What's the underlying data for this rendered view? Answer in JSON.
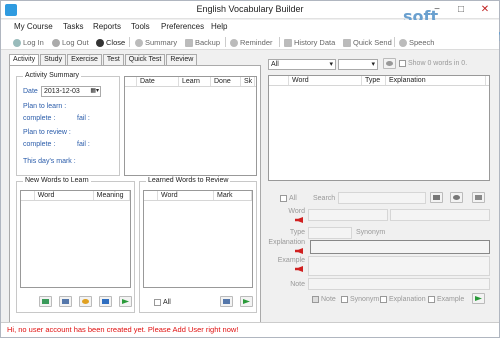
{
  "window": {
    "title": "English Vocabulary Builder",
    "min": "−",
    "max": "□",
    "close": "✕"
  },
  "menu": [
    "My Course",
    "Tasks",
    "Reports",
    "Tools",
    "Preferences",
    "Help"
  ],
  "toolbar": {
    "login": "Log In",
    "logout": "Log Out",
    "close": "Close",
    "summary": "Summary",
    "backup": "Backup",
    "reminder": "Reminder",
    "history": "History Data",
    "quicksend": "Quick Send",
    "speech": "Speech"
  },
  "tabs": [
    "Activity",
    "Study",
    "Exercise",
    "Test",
    "Quick Test",
    "Review"
  ],
  "activity": {
    "group_title": "Activity Summary",
    "date_label": "Date",
    "date_value": "2013-12-03",
    "plan_learn": "Plan to learn :",
    "complete1": "complete :",
    "fail1": "fail :",
    "plan_review": "Plan to review :",
    "complete2": "complete :",
    "fail2": "fail :",
    "days_mark": "This day's mark :"
  },
  "activity_list": {
    "columns": [
      "Date",
      "Learn",
      "Done",
      "Sk"
    ]
  },
  "new_words": {
    "title": "New Words to Learn",
    "columns": [
      "Word",
      "Meaning"
    ]
  },
  "learned_words": {
    "title": "Learned Words to Review",
    "columns": [
      "Word",
      "Mark"
    ],
    "all_label": "All"
  },
  "right": {
    "filter": "All",
    "show_text": "Show 0 words in 0.",
    "columns": [
      "Word",
      "Type",
      "Explanation"
    ],
    "all_label": "All",
    "search_label": "Search"
  },
  "detail": {
    "word": "Word",
    "type": "Type",
    "synonym": "Synonym",
    "explanation": "Explanation",
    "example": "Example",
    "note": "Note"
  },
  "options": {
    "note": "Note",
    "synonym": "Synonym",
    "explanation": "Explanation",
    "example": "Example"
  },
  "status": "Hi, no user account has been created yet. Please Add User right now!",
  "watermark": "soft planet.com"
}
